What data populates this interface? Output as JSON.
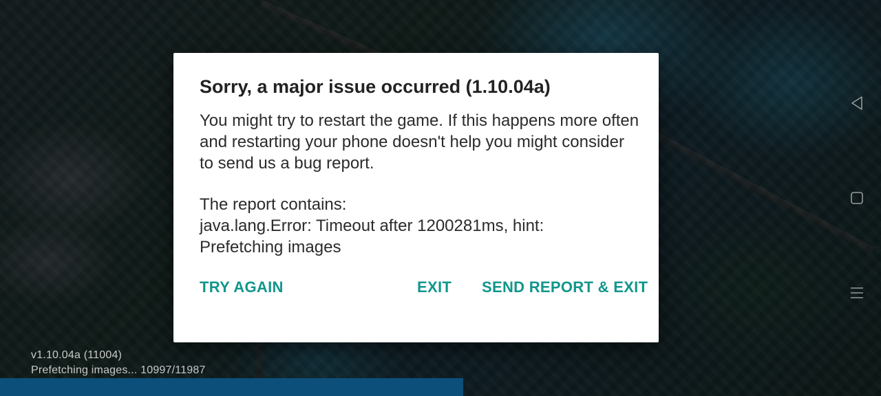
{
  "background": {
    "version": "v1.10.04a (11004)",
    "status": "Prefetching images... 10997/11987",
    "progress_fraction": 0.526,
    "colors": {
      "progress": "#0c4f7a"
    }
  },
  "dialog": {
    "title": "Sorry, a major issue occurred (1.10.04a)",
    "message": "You might try to restart the game. If this happens more often and restarting your phone doesn't help you might consider to send us a bug report.",
    "report_heading": "The report contains:",
    "report_error": "java.lang.Error: Timeout after 1200281ms, hint:",
    "report_hint": "Prefetching images",
    "buttons": {
      "try_again": "TRY AGAIN",
      "exit": "EXIT",
      "send_report": "SEND REPORT & EXIT"
    },
    "colors": {
      "button": "#11968c"
    }
  },
  "nav": {
    "icons": [
      "back-icon",
      "home-icon",
      "menu-icon"
    ]
  }
}
